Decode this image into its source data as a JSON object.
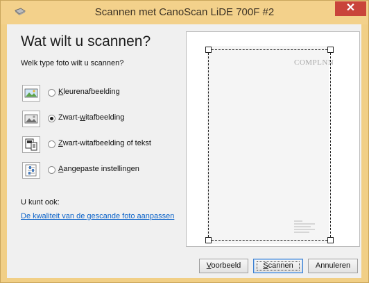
{
  "window": {
    "title": "Scannen met CanoScan LiDE 700F #2",
    "close_glyph": "✕"
  },
  "main": {
    "heading": "Wat wilt u scannen?",
    "subheading": "Welk type foto wilt u scannen?",
    "options": [
      {
        "label": "Kleurenafbeelding",
        "icon": "color-picture-icon",
        "selected": false
      },
      {
        "label": "Zwart-witafbeelding",
        "icon": "grayscale-picture-icon",
        "selected": true
      },
      {
        "label": "Zwart-witafbeelding of tekst",
        "icon": "text-picture-icon",
        "selected": false
      },
      {
        "label": "Aangepaste instellingen",
        "icon": "custom-settings-icon",
        "selected": false
      }
    ],
    "also_label": "U kunt ook:",
    "adjust_link": "De kwaliteit van de gescande foto aanpassen"
  },
  "preview": {
    "logo_text": "COMPLNN"
  },
  "buttons": {
    "preview": "Voorbeeld",
    "scan": "Scannen",
    "cancel": "Annuleren"
  },
  "colors": {
    "frame": "#f1cf86",
    "close_button": "#c9443a",
    "link": "#0a62c9"
  }
}
